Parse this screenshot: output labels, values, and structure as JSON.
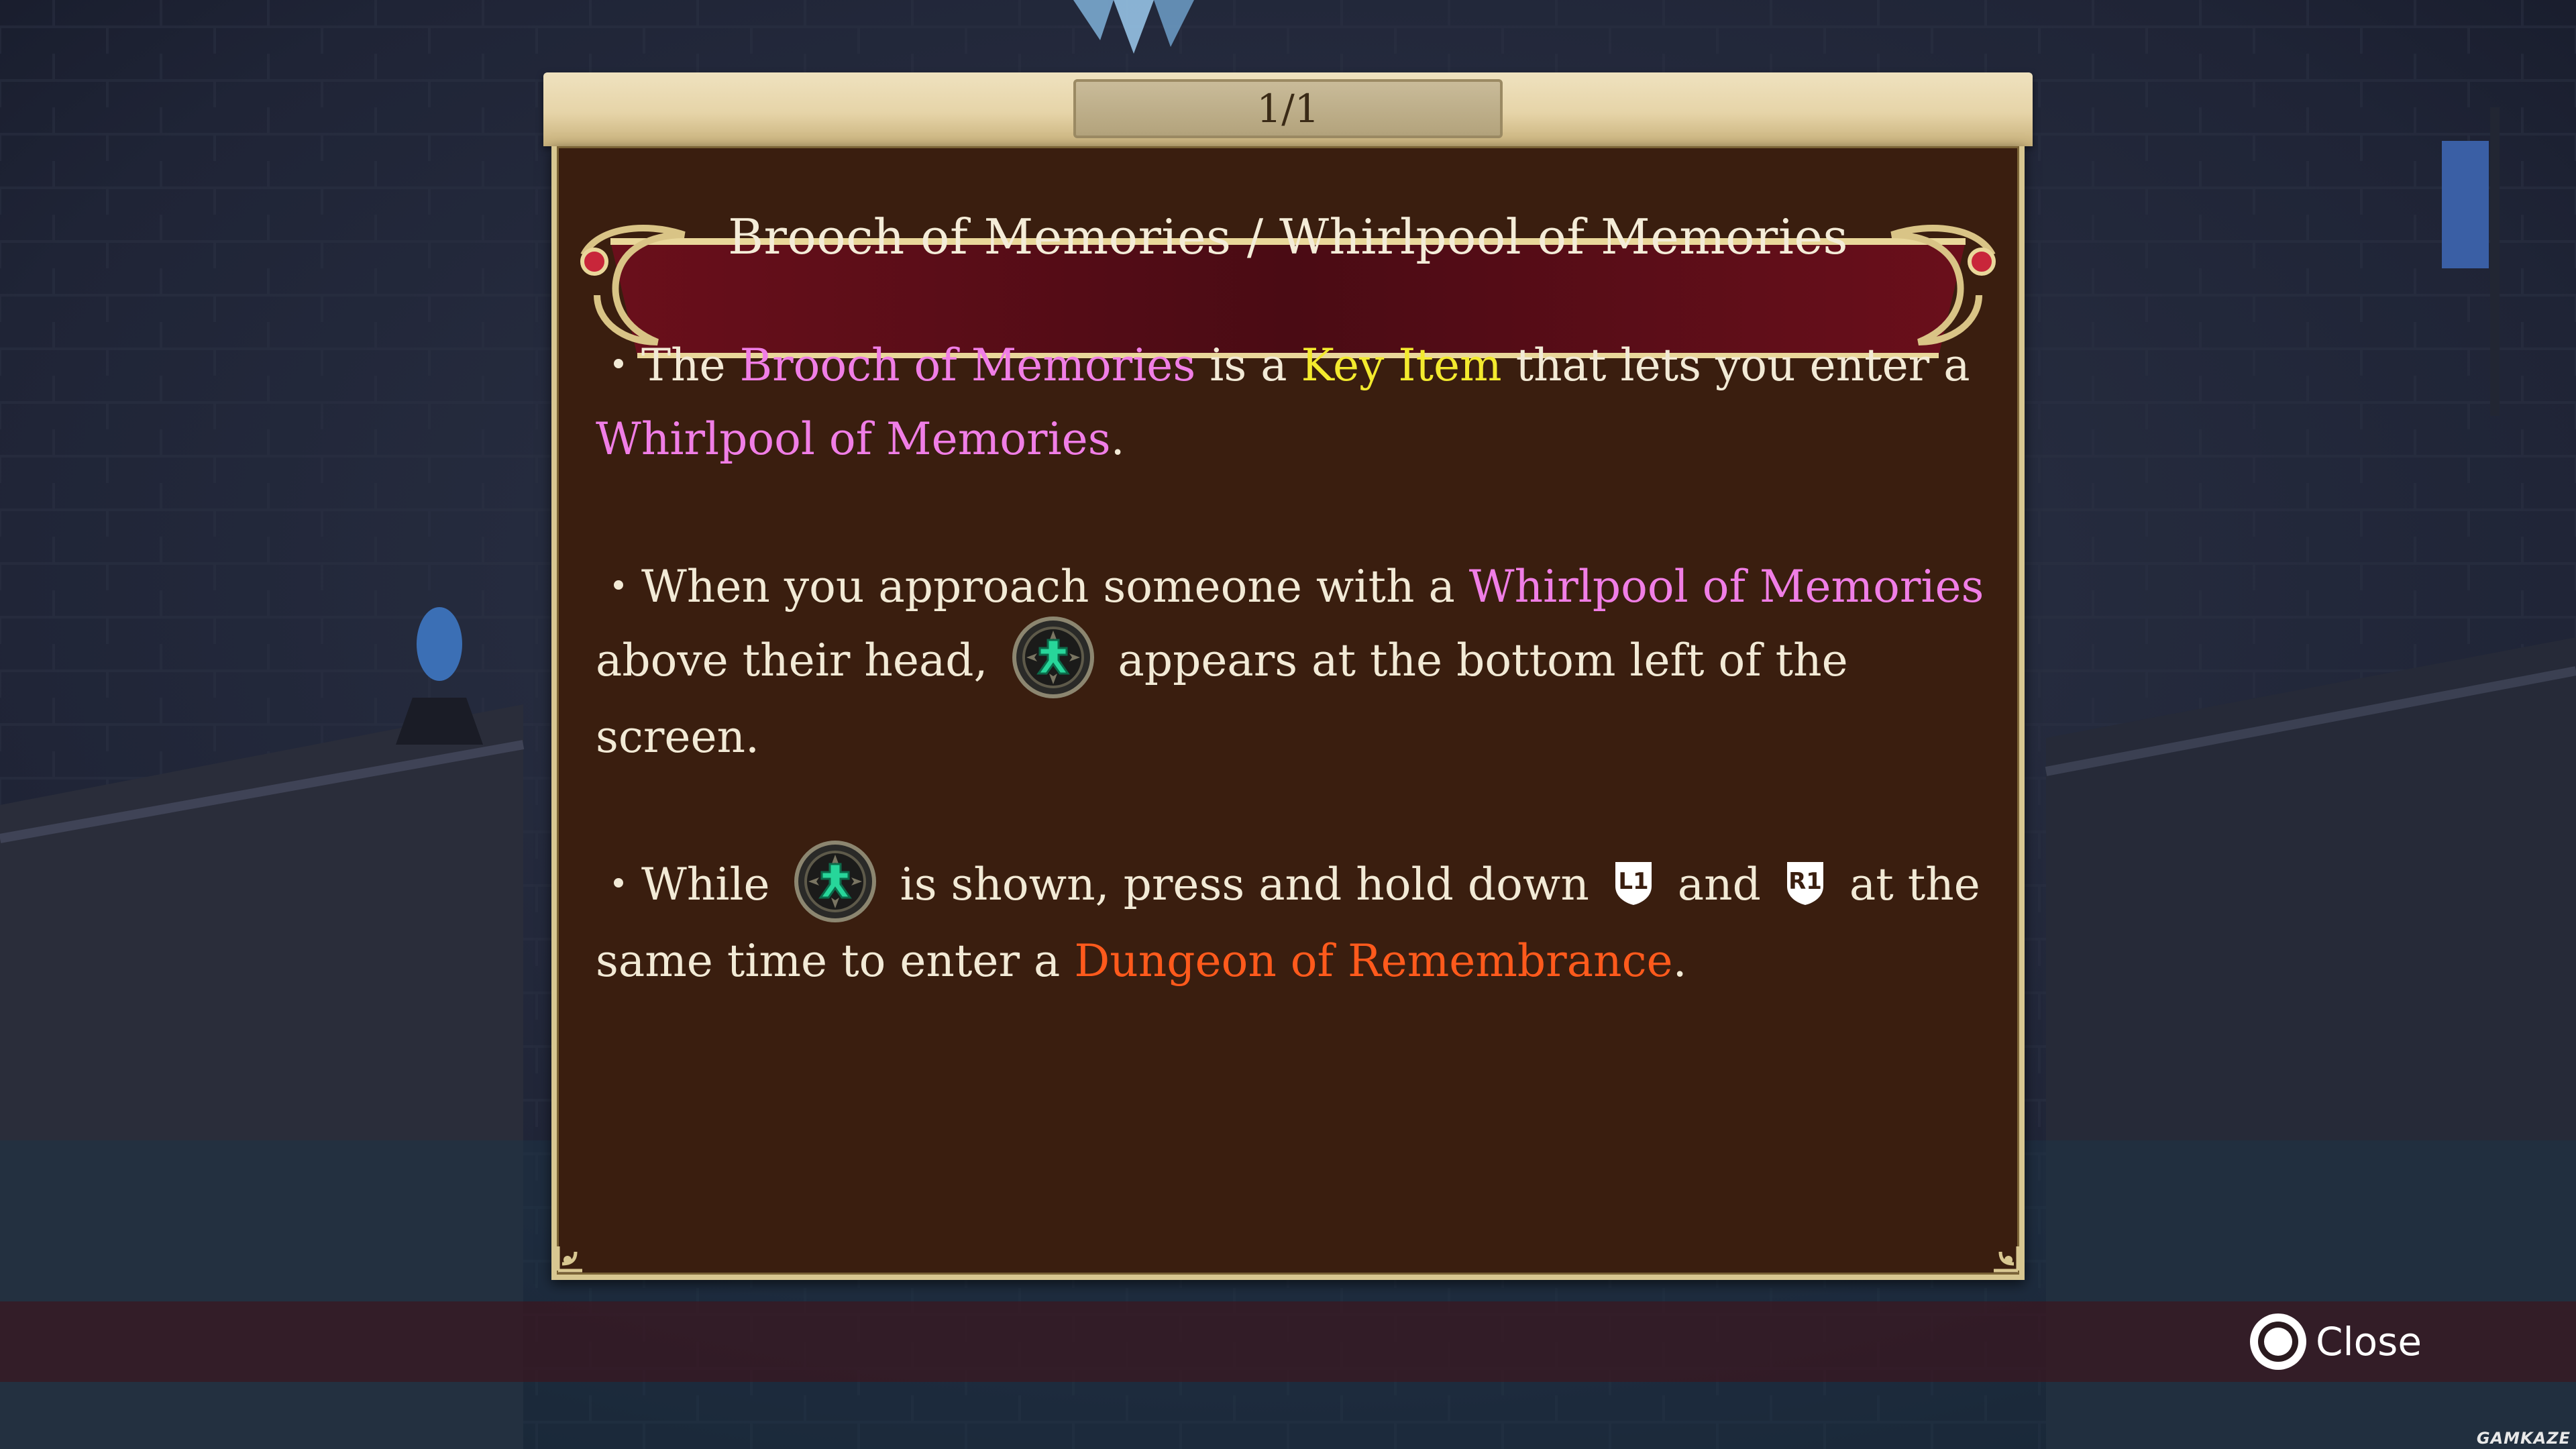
{
  "panel": {
    "page_indicator": "1/1",
    "title": "Brooch of Memories / Whirlpool of Memories",
    "paragraphs": [
      {
        "bullet": "・",
        "segments": [
          {
            "text": "The ",
            "style": "plain"
          },
          {
            "text": "Brooch of Memories",
            "style": "pink"
          },
          {
            "text": " is a ",
            "style": "plain"
          },
          {
            "text": "Key Item",
            "style": "yellow"
          },
          {
            "text": " that lets you enter a ",
            "style": "plain"
          },
          {
            "text": "Whirlpool of Memories",
            "style": "pink"
          },
          {
            "text": ".",
            "style": "plain"
          }
        ]
      },
      {
        "bullet": "・",
        "segments": [
          {
            "text": "When you approach someone with a ",
            "style": "plain"
          },
          {
            "text": "Whirlpool of Memories",
            "style": "pink"
          },
          {
            "text": " above their head, ",
            "style": "plain"
          },
          {
            "icon": "brooch-icon"
          },
          {
            "text": " appears at the bottom left of the screen.",
            "style": "plain"
          }
        ]
      },
      {
        "bullet": "・",
        "segments": [
          {
            "text": "While ",
            "style": "plain"
          },
          {
            "icon": "brooch-icon"
          },
          {
            "text": " is shown, press and hold down ",
            "style": "plain"
          },
          {
            "icon": "l1-button-icon",
            "label": "L1"
          },
          {
            "text": " and ",
            "style": "plain"
          },
          {
            "icon": "r1-button-icon",
            "label": "R1"
          },
          {
            "text": " at the same time to enter a ",
            "style": "plain"
          },
          {
            "text": "Dungeon of Remembrance",
            "style": "orange"
          },
          {
            "text": ".",
            "style": "plain"
          }
        ]
      }
    ]
  },
  "controls": {
    "close_label": "Close",
    "close_icon": "circle-button-icon"
  },
  "watermark": "GAMKAZE",
  "colors": {
    "highlight_pink": "#f07ee6",
    "highlight_yellow": "#f3ea2e",
    "highlight_orange": "#ff5a1c",
    "body_text": "#f2ead6",
    "panel_background": "#3a1e0f",
    "frame_gold": "#d8c791",
    "banner_red": "#7a1220"
  }
}
